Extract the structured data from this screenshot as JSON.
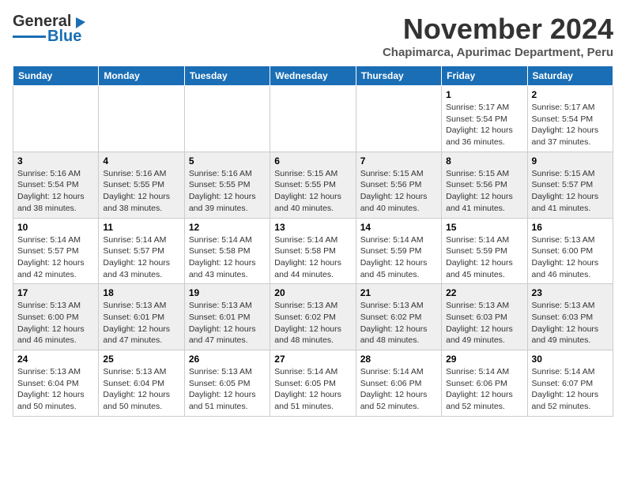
{
  "header": {
    "logo_line1": "General",
    "logo_line2": "Blue",
    "month_title": "November 2024",
    "subtitle": "Chapimarca, Apurimac Department, Peru"
  },
  "weekdays": [
    "Sunday",
    "Monday",
    "Tuesday",
    "Wednesday",
    "Thursday",
    "Friday",
    "Saturday"
  ],
  "weeks": [
    [
      {
        "day": "",
        "info": ""
      },
      {
        "day": "",
        "info": ""
      },
      {
        "day": "",
        "info": ""
      },
      {
        "day": "",
        "info": ""
      },
      {
        "day": "",
        "info": ""
      },
      {
        "day": "1",
        "info": "Sunrise: 5:17 AM\nSunset: 5:54 PM\nDaylight: 12 hours\nand 36 minutes."
      },
      {
        "day": "2",
        "info": "Sunrise: 5:17 AM\nSunset: 5:54 PM\nDaylight: 12 hours\nand 37 minutes."
      }
    ],
    [
      {
        "day": "3",
        "info": "Sunrise: 5:16 AM\nSunset: 5:54 PM\nDaylight: 12 hours\nand 38 minutes."
      },
      {
        "day": "4",
        "info": "Sunrise: 5:16 AM\nSunset: 5:55 PM\nDaylight: 12 hours\nand 38 minutes."
      },
      {
        "day": "5",
        "info": "Sunrise: 5:16 AM\nSunset: 5:55 PM\nDaylight: 12 hours\nand 39 minutes."
      },
      {
        "day": "6",
        "info": "Sunrise: 5:15 AM\nSunset: 5:55 PM\nDaylight: 12 hours\nand 40 minutes."
      },
      {
        "day": "7",
        "info": "Sunrise: 5:15 AM\nSunset: 5:56 PM\nDaylight: 12 hours\nand 40 minutes."
      },
      {
        "day": "8",
        "info": "Sunrise: 5:15 AM\nSunset: 5:56 PM\nDaylight: 12 hours\nand 41 minutes."
      },
      {
        "day": "9",
        "info": "Sunrise: 5:15 AM\nSunset: 5:57 PM\nDaylight: 12 hours\nand 41 minutes."
      }
    ],
    [
      {
        "day": "10",
        "info": "Sunrise: 5:14 AM\nSunset: 5:57 PM\nDaylight: 12 hours\nand 42 minutes."
      },
      {
        "day": "11",
        "info": "Sunrise: 5:14 AM\nSunset: 5:57 PM\nDaylight: 12 hours\nand 43 minutes."
      },
      {
        "day": "12",
        "info": "Sunrise: 5:14 AM\nSunset: 5:58 PM\nDaylight: 12 hours\nand 43 minutes."
      },
      {
        "day": "13",
        "info": "Sunrise: 5:14 AM\nSunset: 5:58 PM\nDaylight: 12 hours\nand 44 minutes."
      },
      {
        "day": "14",
        "info": "Sunrise: 5:14 AM\nSunset: 5:59 PM\nDaylight: 12 hours\nand 45 minutes."
      },
      {
        "day": "15",
        "info": "Sunrise: 5:14 AM\nSunset: 5:59 PM\nDaylight: 12 hours\nand 45 minutes."
      },
      {
        "day": "16",
        "info": "Sunrise: 5:13 AM\nSunset: 6:00 PM\nDaylight: 12 hours\nand 46 minutes."
      }
    ],
    [
      {
        "day": "17",
        "info": "Sunrise: 5:13 AM\nSunset: 6:00 PM\nDaylight: 12 hours\nand 46 minutes."
      },
      {
        "day": "18",
        "info": "Sunrise: 5:13 AM\nSunset: 6:01 PM\nDaylight: 12 hours\nand 47 minutes."
      },
      {
        "day": "19",
        "info": "Sunrise: 5:13 AM\nSunset: 6:01 PM\nDaylight: 12 hours\nand 47 minutes."
      },
      {
        "day": "20",
        "info": "Sunrise: 5:13 AM\nSunset: 6:02 PM\nDaylight: 12 hours\nand 48 minutes."
      },
      {
        "day": "21",
        "info": "Sunrise: 5:13 AM\nSunset: 6:02 PM\nDaylight: 12 hours\nand 48 minutes."
      },
      {
        "day": "22",
        "info": "Sunrise: 5:13 AM\nSunset: 6:03 PM\nDaylight: 12 hours\nand 49 minutes."
      },
      {
        "day": "23",
        "info": "Sunrise: 5:13 AM\nSunset: 6:03 PM\nDaylight: 12 hours\nand 49 minutes."
      }
    ],
    [
      {
        "day": "24",
        "info": "Sunrise: 5:13 AM\nSunset: 6:04 PM\nDaylight: 12 hours\nand 50 minutes."
      },
      {
        "day": "25",
        "info": "Sunrise: 5:13 AM\nSunset: 6:04 PM\nDaylight: 12 hours\nand 50 minutes."
      },
      {
        "day": "26",
        "info": "Sunrise: 5:13 AM\nSunset: 6:05 PM\nDaylight: 12 hours\nand 51 minutes."
      },
      {
        "day": "27",
        "info": "Sunrise: 5:14 AM\nSunset: 6:05 PM\nDaylight: 12 hours\nand 51 minutes."
      },
      {
        "day": "28",
        "info": "Sunrise: 5:14 AM\nSunset: 6:06 PM\nDaylight: 12 hours\nand 52 minutes."
      },
      {
        "day": "29",
        "info": "Sunrise: 5:14 AM\nSunset: 6:06 PM\nDaylight: 12 hours\nand 52 minutes."
      },
      {
        "day": "30",
        "info": "Sunrise: 5:14 AM\nSunset: 6:07 PM\nDaylight: 12 hours\nand 52 minutes."
      }
    ]
  ]
}
